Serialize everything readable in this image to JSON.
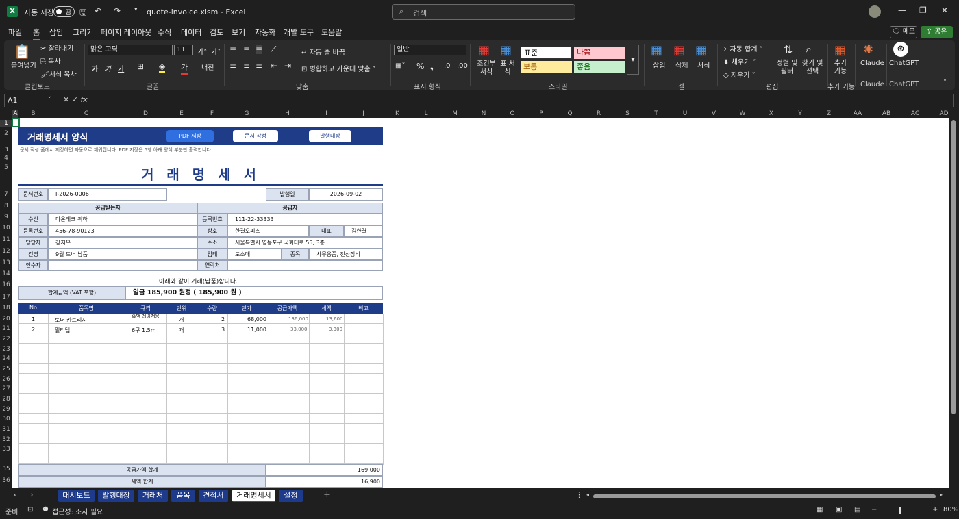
{
  "app": {
    "filename": "quote-invoice.xlsm  -  Excel",
    "autosave_label": "자동 저장",
    "autosave_state": "끔",
    "search_placeholder": "검색"
  },
  "menu": [
    "파일",
    "홈",
    "삽입",
    "그리기",
    "페이지 레이아웃",
    "수식",
    "데이터",
    "검토",
    "보기",
    "자동화",
    "개발 도구",
    "도움말"
  ],
  "menu_right": {
    "memo": "메모",
    "share": "공유"
  },
  "ribbon": {
    "clipboard": {
      "paste": "붙여넣기",
      "cut": "잘라내기",
      "copy": "복사",
      "format_painter": "서식 복사",
      "label": "클립보드"
    },
    "font": {
      "name": "맑은 고딕",
      "size": "11",
      "label": "글꼴"
    },
    "align": {
      "wrap": "자동 줄 바꿈",
      "merge": "병합하고 가운데 맞춤",
      "label": "맞춤"
    },
    "number": {
      "format": "일반",
      "label": "표시 형식"
    },
    "styles": {
      "cond": "조건부 서식",
      "table": "표 서식",
      "normal": "표준",
      "bad": "나쁨",
      "neutral": "보통",
      "good": "좋음",
      "label": "스타일"
    },
    "cells": {
      "insert": "삽입",
      "delete": "삭제",
      "format": "서식",
      "label": "셀"
    },
    "editing": {
      "autosum": "자동 합계",
      "fill": "채우기",
      "clear": "지우기",
      "sort": "정렬 및 필터",
      "find": "찾기 및 선택",
      "label": "편집"
    },
    "addins": {
      "btn": "추가 기능",
      "label": "추가 기능"
    },
    "claude": {
      "btn": "Claude",
      "label": "Claude"
    },
    "chatgpt": {
      "btn": "ChatGPT",
      "label": "ChatGPT"
    }
  },
  "namebox": "A1",
  "columns": [
    "A",
    "B",
    "C",
    "D",
    "E",
    "F",
    "G",
    "H",
    "I",
    "J",
    "K",
    "L",
    "M",
    "N",
    "O",
    "P",
    "Q",
    "R",
    "S",
    "T",
    "U",
    "V",
    "W",
    "X",
    "Y",
    "Z",
    "AA",
    "AB",
    "AC",
    "AD"
  ],
  "rows": [
    "1",
    "2",
    "3",
    "4",
    "5",
    "7",
    "8",
    "9",
    "10",
    "11",
    "12",
    "13",
    "14",
    "16",
    "17",
    "18",
    "20",
    "21",
    "22",
    "23",
    "24",
    "25",
    "26",
    "27",
    "28",
    "29",
    "30",
    "31",
    "32",
    "33",
    "35",
    "36"
  ],
  "doc": {
    "banner_title": "거래명세서 양식",
    "btn_pdf": "PDF 저장",
    "btn_create": "문서 작성",
    "btn_ledger": "발행대장",
    "note": "문서 작성 폼에서 저장하면 자동으로 채워집니다. PDF 저장은 5행 아래 양식 부분만 출력합니다.",
    "title": "거 래 명 세 서",
    "docno_label": "문서번호",
    "docno": "I-2026-0006",
    "issue_label": "발행일",
    "issue_date": "2026-09-02",
    "recv_head": "공급받는자",
    "supp_head": "공급자",
    "recv": [
      {
        "k": "수신",
        "v": "다온테크 귀하"
      },
      {
        "k": "등록번호",
        "v": "456-78-90123"
      },
      {
        "k": "담당자",
        "v": "강지우"
      },
      {
        "k": "건명",
        "v": "9월 토너 납품"
      },
      {
        "k": "인수자",
        "v": ""
      }
    ],
    "supp_regno_label": "등록번호",
    "supp_regno": "111-22-33333",
    "supp_name_label": "상호",
    "supp_name": "한결오피스",
    "rep_label": "대표",
    "rep": "김한결",
    "addr_label": "주소",
    "addr": "서울특별시 영등포구 국회대로 55, 3층",
    "biz_label": "업태",
    "biz": "도소매",
    "item_label": "종목",
    "item": "사무용품, 전산장비",
    "contact_label": "연락처",
    "contact": "",
    "sentence": "아래와 같이 거래(납품)합니다.",
    "total_label": "합계금액 (VAT 포함)",
    "total_text": "일금 185,900 원정  ( 185,900 원 )",
    "headers": [
      "No",
      "품목명",
      "규격",
      "단위",
      "수량",
      "단가",
      "공급가액",
      "세액",
      "비고"
    ],
    "items": [
      {
        "no": "1",
        "name": "토너 카트리지",
        "spec": "흑백 레이저용",
        "unit": "개",
        "qty": "2",
        "price": "68,000",
        "supply": "136,000",
        "tax": "13,600",
        "note": ""
      },
      {
        "no": "2",
        "name": "멀티탭",
        "spec": "6구 1.5m",
        "unit": "개",
        "qty": "3",
        "price": "11,000",
        "supply": "33,000",
        "tax": "3,300",
        "note": ""
      }
    ],
    "sum_supply_label": "공급가액 합계",
    "sum_supply": "169,000",
    "sum_tax_label": "세액 합계",
    "sum_tax": "16,900"
  },
  "tabs": [
    "대시보드",
    "발행대장",
    "거래처",
    "품목",
    "견적서",
    "거래명세서",
    "설정"
  ],
  "status": {
    "ready": "준비",
    "accessibility": "접근성: 조사 필요",
    "zoom": "80%"
  }
}
